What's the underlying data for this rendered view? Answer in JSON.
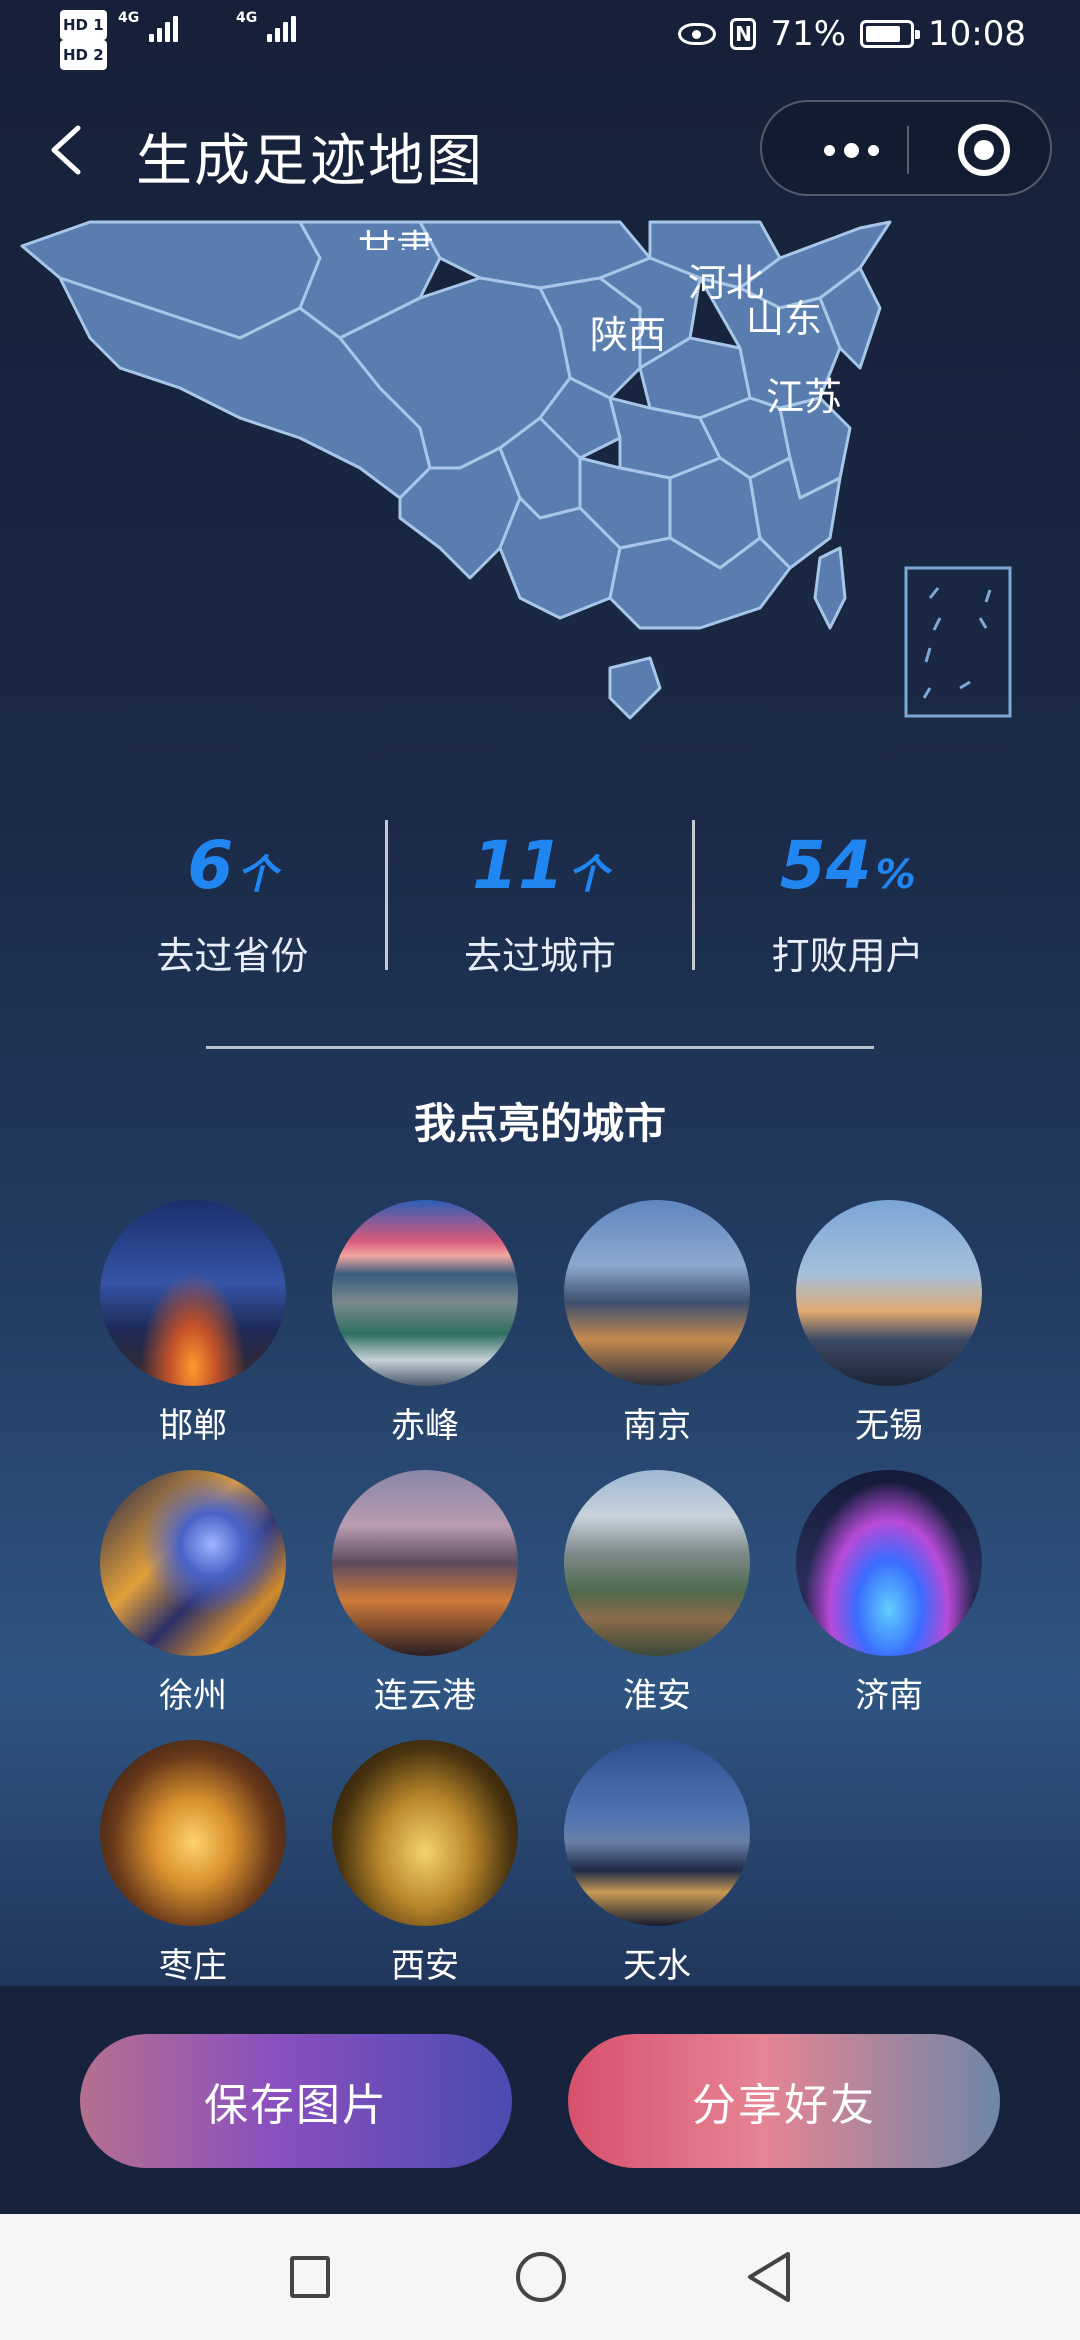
{
  "status_bar": {
    "hd1": "HD 1",
    "hd2": "HD 2",
    "net1": "4G",
    "net2": "4G",
    "battery": "71%",
    "time": "10:08"
  },
  "title_bar": {
    "title": "生成足迹地图"
  },
  "map": {
    "labels": [
      "甘肃",
      "河北",
      "山东",
      "陕西",
      "江苏"
    ],
    "colors": {
      "province_fill": "#5a7db0",
      "province_border": "#a8c7e8"
    }
  },
  "stats": [
    {
      "value": "6",
      "unit": "个",
      "label": "去过省份"
    },
    {
      "value": "11",
      "unit": "个",
      "label": "去过城市"
    },
    {
      "value": "54",
      "unit": "%",
      "label": "打败用户"
    }
  ],
  "section_title": "我点亮的城市",
  "cities": [
    {
      "name": "邯郸"
    },
    {
      "name": "赤峰"
    },
    {
      "name": "南京"
    },
    {
      "name": "无锡"
    },
    {
      "name": "徐州"
    },
    {
      "name": "连云港"
    },
    {
      "name": "淮安"
    },
    {
      "name": "济南"
    },
    {
      "name": "枣庄"
    },
    {
      "name": "西安"
    },
    {
      "name": "天水"
    }
  ],
  "actions": {
    "save_label": "保存图片",
    "share_label": "分享好友"
  },
  "colors": {
    "accent_blue": "#1f86f2"
  }
}
